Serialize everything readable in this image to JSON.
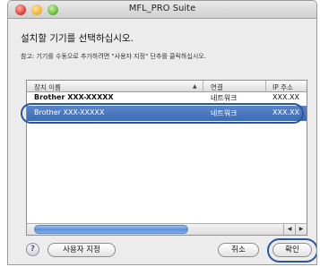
{
  "window": {
    "title": "MFL_PRO Suite"
  },
  "heading": "설치할 기기를 선택하십시오.",
  "note": "참고: 기기를 수동으로 추가하려면 \"사용자 지정\" 단추를 클릭하십시오.",
  "table": {
    "columns": {
      "name": "장치 이름",
      "connection": "연결",
      "ip": "IP 주소"
    },
    "rows": [
      {
        "name": "Brother XXX-XXXXX",
        "connection": "네트워크",
        "ip": "XXX.XX"
      },
      {
        "name": "Brother XXX-XXXXX",
        "connection": "네트워크",
        "ip": "XXX.XX"
      }
    ]
  },
  "buttons": {
    "help": "?",
    "custom": "사용자 지정",
    "cancel": "취소",
    "ok": "확인"
  },
  "icons": {
    "sort": "sort-up-icon",
    "scroll_left": "scroll-left-icon",
    "scroll_right": "scroll-right-icon"
  },
  "colors": {
    "selection": "#3d6bb5",
    "highlight_ring": "#2c5698"
  }
}
